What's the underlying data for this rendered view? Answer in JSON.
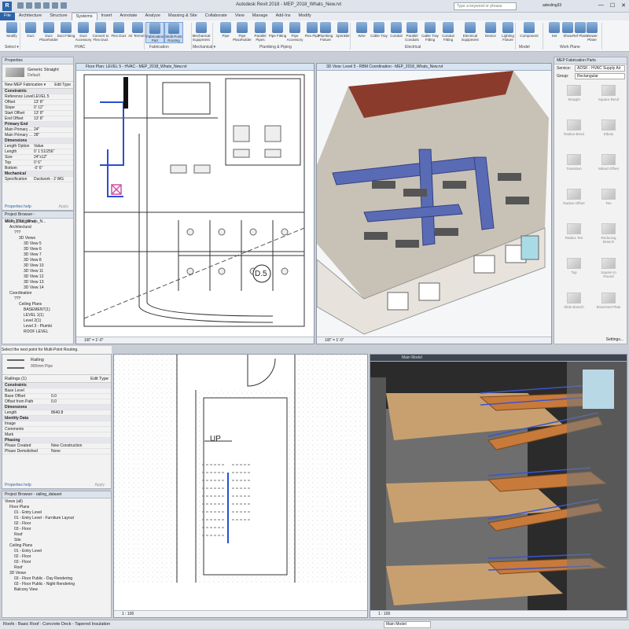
{
  "app": {
    "logo": "R",
    "title": "Autodesk Revit 2018 -    MEP_2018_Whats_New.rvt",
    "search_placeholder": "Type a keyword or phrase",
    "user": "adesling33",
    "window_controls": [
      "—",
      "☐",
      "✕"
    ]
  },
  "tabs": [
    "File",
    "Architecture",
    "Structure",
    "Systems",
    "Insert",
    "Annotate",
    "Analyze",
    "Massing & Site",
    "Collaborate",
    "View",
    "Manage",
    "Add-Ins",
    "Modify"
  ],
  "ribbon": {
    "buttons": [
      "Modify",
      "Duct",
      "Duct Placeholder",
      "Duct Fitting",
      "Duct Accessory",
      "Convert to Flex Duct",
      "Flex Duct",
      "Air Terminal",
      "Fabrication Part",
      "Multi-Point Routing",
      "Mechanical Equipment",
      "Pipe",
      "Pipe Placeholder",
      "Parallel Pipes",
      "Pipe Fitting",
      "Pipe Accessory",
      "Flex Pipe",
      "Plumbing Fixture",
      "Sprinkler",
      "Wire",
      "Cable Tray",
      "Conduit",
      "Parallel Conduits",
      "Cable Tray Fitting",
      "Conduit Fitting",
      "Electrical Equipment",
      "Device",
      "Lighting Fixture",
      "Component",
      "Set",
      "Show",
      "Ref Plane",
      "Viewer Plane"
    ],
    "groups": [
      "Select ▾",
      "HVAC",
      "Fabrication",
      "Mechanical ▾",
      "Plumbing & Piping",
      "Electrical",
      "Model",
      "Work Plane"
    ]
  },
  "properties_top": {
    "header": "Properties",
    "type_name": "Generic Straight",
    "type_sub": "Default",
    "selector": "New MEP Fabrication ▾",
    "edit_type": "Edit Type",
    "rows": [
      {
        "label": "Constraints",
        "value": "",
        "cat": true
      },
      {
        "label": "Reference Level",
        "value": "LEVEL 5"
      },
      {
        "label": "Offset",
        "value": "13' 8\""
      },
      {
        "label": "Slope",
        "value": "0' 12\""
      },
      {
        "label": "Start Offset",
        "value": "13' 8\""
      },
      {
        "label": "End Offset",
        "value": "13' 8\""
      },
      {
        "label": "Primary End",
        "value": "",
        "cat": true
      },
      {
        "label": "Main Primary ...",
        "value": "24\""
      },
      {
        "label": "Main Primary ...",
        "value": "28\""
      },
      {
        "label": "Dimensions",
        "value": "",
        "cat": true
      },
      {
        "label": "Length Option",
        "value": "Value"
      },
      {
        "label": "Length",
        "value": "0' 1 51/256\""
      },
      {
        "label": "Size",
        "value": "24\"x12\""
      },
      {
        "label": "Top",
        "value": "0' 6\""
      },
      {
        "label": "Bottom",
        "value": "-0' 6\""
      },
      {
        "label": "Mechanical",
        "value": "",
        "cat": true
      },
      {
        "label": "Specification",
        "value": "Ductwork - 2 WG"
      }
    ],
    "help": "Properties help",
    "apply": "Apply"
  },
  "browser_top": {
    "header": "Project Browser - MEP_2018_Whats_N...",
    "items": [
      "Views (Discipline)",
      "Architectural",
      "???",
      "3D Views",
      "3D View 5",
      "3D View 6",
      "3D View 7",
      "3D View 8",
      "3D View 10",
      "3D View 11",
      "3D View 12",
      "3D View 13",
      "3D View 14",
      "Coordination",
      "???",
      "Ceiling Plans",
      "BASEMENT(1)",
      "LEVEL 1(1)",
      "Level 2(1)",
      "Level 3 - Plumbi",
      "ROOF LEVEL"
    ]
  },
  "view1": {
    "title": "Floor Plan: LEVEL 5 - HVAC - MEP_2018_Whats_New.rvt",
    "tag": "D.5",
    "scale": "1/8\" = 1'-0\""
  },
  "view2": {
    "title": "3D View: Level 5 - RBM Coordination - MEP_2018_Whats_New.rvt",
    "scale": "1/8\" = 1'-0\""
  },
  "fab_panel": {
    "header": "MEP Fabrication Parts",
    "service_label": "Service:",
    "service_value": "ADSK - HVAC Supply Air",
    "group_label": "Group:",
    "group_value": "Rectangular",
    "items": [
      "Straight",
      "Square Bend",
      "Radius Bend",
      "Elbow",
      "Transition",
      "Mitred Offset",
      "Radius Offset",
      "Tee",
      "Radius Tee",
      "Reducing Branch",
      "Tap",
      "Square to Round",
      "Slide Branch",
      "Branched Plate"
    ],
    "settings": "Settings..."
  },
  "hint": "Select the next point for Multi-Point Routing.",
  "properties_bottom": {
    "type_name": "Railing",
    "type_sub": "900mm Pipe",
    "selector": "Railings (1)",
    "edit_type": "Edit Type",
    "rows": [
      {
        "label": "Constraints",
        "value": "",
        "cat": true
      },
      {
        "label": "Base Level",
        "value": ""
      },
      {
        "label": "Base Offset",
        "value": "0.0"
      },
      {
        "label": "Offset from Path",
        "value": "0.0"
      },
      {
        "label": "Dimensions",
        "value": "",
        "cat": true
      },
      {
        "label": "Length",
        "value": "8640.8"
      },
      {
        "label": "Identity Data",
        "value": "",
        "cat": true
      },
      {
        "label": "Image",
        "value": ""
      },
      {
        "label": "Comments",
        "value": ""
      },
      {
        "label": "Mark",
        "value": ""
      },
      {
        "label": "Phasing",
        "value": "",
        "cat": true
      },
      {
        "label": "Phase Created",
        "value": "New Construction"
      },
      {
        "label": "Phase Demolished",
        "value": "None"
      }
    ],
    "help": "Properties help",
    "apply": "Apply"
  },
  "browser_bottom": {
    "header": "Project Browser - railing_dataset",
    "items": [
      "Views (all)",
      "Floor Plans",
      "01 - Entry Level",
      "01 - Entry Level - Furniture Layout",
      "02 - Floor",
      "03 - Floor",
      "Roof",
      "Site",
      "Ceiling Plans",
      "01 - Entry Level",
      "02 - Floor",
      "03 - Floor",
      "Roof",
      "3D Views",
      "03 - Floor Public - Day Rendering",
      "03 - Floor Public - Night Rendering",
      "Balcony View"
    ]
  },
  "view3": {
    "label": "UP",
    "scale": "1 : 100"
  },
  "view4": {
    "model": "Main Model",
    "scale": "1 : 100"
  },
  "status": {
    "text": "Roofs : Basic Roof : Concrete Deck - Tapered Insulation",
    "model": "Main Model"
  }
}
